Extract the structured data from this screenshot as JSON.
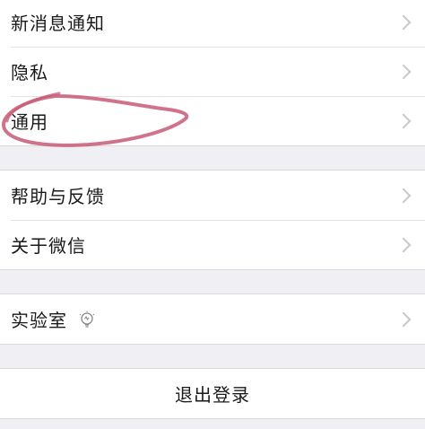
{
  "settings": {
    "group1": [
      {
        "label": "新消息通知"
      },
      {
        "label": "隐私"
      },
      {
        "label": "通用"
      }
    ],
    "group2": [
      {
        "label": "帮助与反馈"
      },
      {
        "label": "关于微信"
      }
    ],
    "group3": [
      {
        "label": "实验室",
        "icon": "lightbulb-icon"
      }
    ],
    "logout_label": "退出登录"
  },
  "colors": {
    "background": "#efeff4",
    "cell": "#ffffff",
    "chevron": "#c7c7cc",
    "annotation": "#c85a75"
  }
}
